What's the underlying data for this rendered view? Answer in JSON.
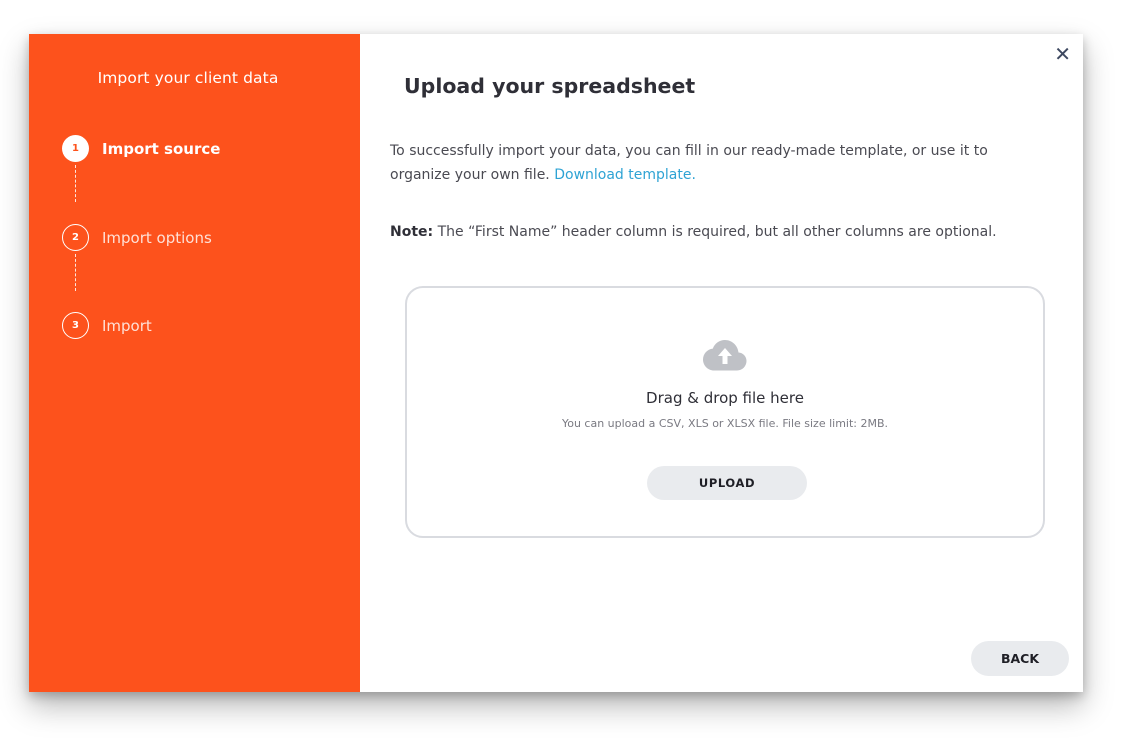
{
  "sidebar": {
    "title": "Import your client data",
    "steps": [
      {
        "number": "1",
        "label": "Import source",
        "state": "active"
      },
      {
        "number": "2",
        "label": "Import options",
        "state": "inactive"
      },
      {
        "number": "3",
        "label": "Import",
        "state": "inactive"
      }
    ]
  },
  "main": {
    "close_icon": "close-icon",
    "close_glyph": "✕",
    "title": "Upload your spreadsheet",
    "intro_text": "To successfully import your data, you can fill in our ready-made template, or use it to organize your own file.",
    "download_link": "Download template.",
    "note_label": "Note:",
    "note_text": "The “First Name” header column is required, but all other columns are optional.",
    "dropzone": {
      "icon": "cloud-upload-icon",
      "title": "Drag & drop file here",
      "subtitle": "You can upload a CSV, XLS or XLSX file. File size limit: 2MB.",
      "upload_label": "UPLOAD"
    },
    "back_label": "BACK"
  },
  "colors": {
    "accent": "#fd521c",
    "link": "#2ea3d4",
    "button_bg": "#e9ebee"
  }
}
